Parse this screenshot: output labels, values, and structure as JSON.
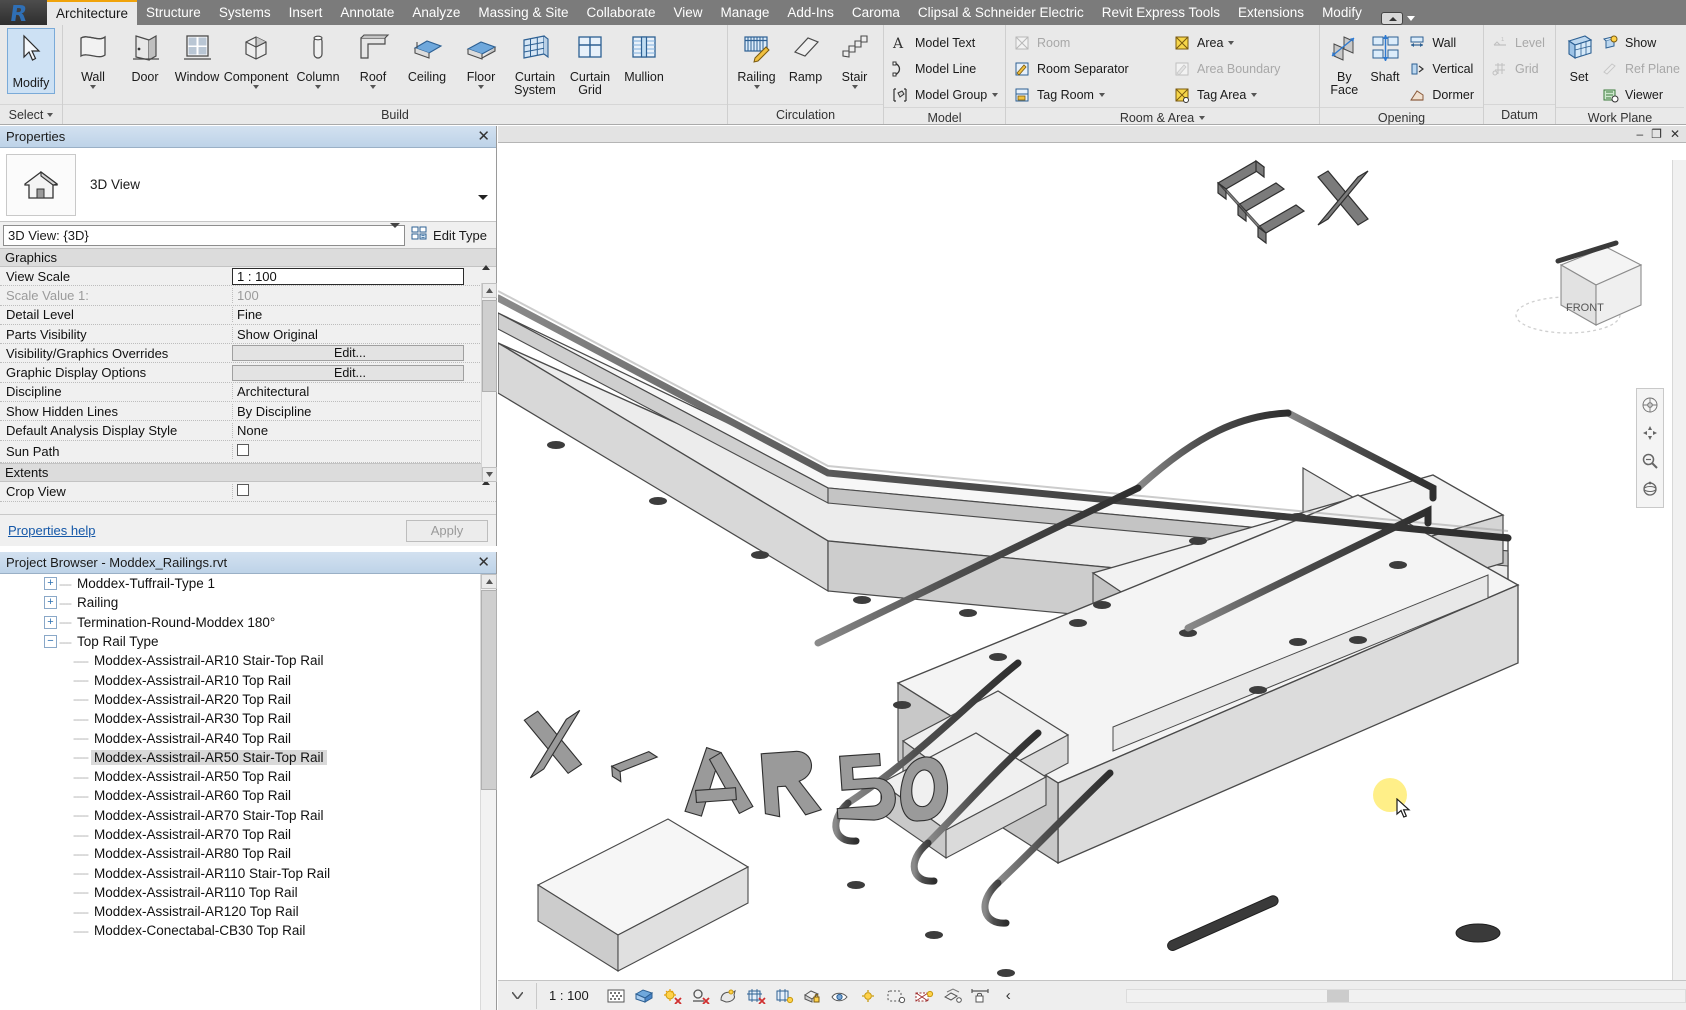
{
  "app": {
    "name": "Autodesk Revit",
    "logo": "revit-logo"
  },
  "ribbon": {
    "tabs": [
      {
        "label": "Architecture",
        "active": true
      },
      {
        "label": "Structure",
        "active": false
      },
      {
        "label": "Systems",
        "active": false
      },
      {
        "label": "Insert",
        "active": false
      },
      {
        "label": "Annotate",
        "active": false
      },
      {
        "label": "Analyze",
        "active": false
      },
      {
        "label": "Massing & Site",
        "active": false
      },
      {
        "label": "Collaborate",
        "active": false
      },
      {
        "label": "View",
        "active": false
      },
      {
        "label": "Manage",
        "active": false
      },
      {
        "label": "Add-Ins",
        "active": false
      },
      {
        "label": "Caroma",
        "active": false
      },
      {
        "label": "Clipsal & Schneider Electric",
        "active": false
      },
      {
        "label": "Revit Express Tools",
        "active": false
      },
      {
        "label": "Extensions",
        "active": false
      },
      {
        "label": "Modify",
        "active": false
      }
    ],
    "select_panel": {
      "modify_label": "Modify",
      "footer_label": "Select"
    },
    "panels": [
      {
        "title": "Build",
        "big_buttons": [
          {
            "label": "Wall",
            "icon": "wall-icon",
            "dropdown": true
          },
          {
            "label": "Door",
            "icon": "door-icon",
            "dropdown": false
          },
          {
            "label": "Window",
            "icon": "window-icon",
            "dropdown": false
          },
          {
            "label": "Component",
            "icon": "component-icon",
            "dropdown": true
          },
          {
            "label": "Column",
            "icon": "column-icon",
            "dropdown": true
          },
          {
            "label": "Roof",
            "icon": "roof-icon",
            "dropdown": true
          },
          {
            "label": "Ceiling",
            "icon": "ceiling-icon",
            "dropdown": false
          },
          {
            "label": "Floor",
            "icon": "floor-icon",
            "dropdown": true
          },
          {
            "label": "Curtain System",
            "icon": "curtain-system-icon",
            "dropdown": false
          },
          {
            "label": "Curtain Grid",
            "icon": "curtain-grid-icon",
            "dropdown": false
          },
          {
            "label": "Mullion",
            "icon": "mullion-icon",
            "dropdown": false
          }
        ]
      },
      {
        "title": "Circulation",
        "big_buttons": [
          {
            "label": "Railing",
            "icon": "railing-icon",
            "dropdown": true
          },
          {
            "label": "Ramp",
            "icon": "ramp-icon",
            "dropdown": false
          },
          {
            "label": "Stair",
            "icon": "stair-icon",
            "dropdown": true
          }
        ]
      },
      {
        "title": "Model",
        "small_buttons": [
          {
            "label": "Model Text",
            "icon": "model-text-icon",
            "disabled": false,
            "dropdown": false
          },
          {
            "label": "Model Line",
            "icon": "model-line-icon",
            "disabled": false,
            "dropdown": false
          },
          {
            "label": "Model Group",
            "icon": "model-group-icon",
            "disabled": false,
            "dropdown": true
          }
        ]
      },
      {
        "title": "Room & Area",
        "title_dropdown": true,
        "small_columns": [
          [
            {
              "label": "Room",
              "icon": "room-icon",
              "disabled": true,
              "dropdown": false
            },
            {
              "label": "Room Separator",
              "icon": "room-separator-icon",
              "disabled": false,
              "dropdown": false
            },
            {
              "label": "Tag Room",
              "icon": "tag-room-icon",
              "disabled": false,
              "dropdown": true
            }
          ],
          [
            {
              "label": "Area",
              "icon": "area-icon",
              "disabled": false,
              "dropdown": true
            },
            {
              "label": "Area Boundary",
              "icon": "area-boundary-icon",
              "disabled": true,
              "dropdown": false
            },
            {
              "label": "Tag Area",
              "icon": "tag-area-icon",
              "disabled": false,
              "dropdown": true
            }
          ]
        ]
      },
      {
        "title": "Opening",
        "big_buttons": [
          {
            "label": "By Face",
            "icon": "by-face-icon",
            "dropdown": false
          },
          {
            "label": "Shaft",
            "icon": "shaft-icon",
            "dropdown": false
          }
        ],
        "small_buttons": [
          {
            "label": "Wall",
            "icon": "opening-wall-icon",
            "disabled": false,
            "dropdown": false
          },
          {
            "label": "Vertical",
            "icon": "opening-vertical-icon",
            "disabled": false,
            "dropdown": false
          },
          {
            "label": "Dormer",
            "icon": "opening-dormer-icon",
            "disabled": false,
            "dropdown": false
          }
        ]
      },
      {
        "title": "Datum",
        "small_buttons": [
          {
            "label": "Level",
            "icon": "level-icon",
            "disabled": true,
            "dropdown": false
          },
          {
            "label": "Grid",
            "icon": "grid-icon",
            "disabled": true,
            "dropdown": false
          }
        ]
      },
      {
        "title": "Work Plane",
        "big_buttons": [
          {
            "label": "Set",
            "icon": "set-workplane-icon",
            "dropdown": false
          }
        ],
        "small_buttons": [
          {
            "label": "Show",
            "icon": "show-workplane-icon",
            "disabled": false,
            "dropdown": false
          },
          {
            "label": "Ref Plane",
            "icon": "ref-plane-icon",
            "disabled": true,
            "dropdown": false
          },
          {
            "label": "Viewer",
            "icon": "workplane-viewer-icon",
            "disabled": false,
            "dropdown": false
          }
        ]
      }
    ]
  },
  "properties": {
    "title": "Properties",
    "close_icon": "close-icon",
    "type_name": "3D View",
    "type_icon": "3d-view-house-icon",
    "selector_value": "3D View: {3D}",
    "edit_type_label": "Edit Type",
    "edit_type_icon": "edit-type-icon",
    "groups": [
      {
        "name": "Graphics",
        "rows": [
          {
            "key": "View Scale",
            "value": "1 : 100",
            "style": "boxed",
            "dim": false
          },
          {
            "key": "Scale Value      1:",
            "value": "100",
            "style": "plain",
            "dim": true
          },
          {
            "key": "Detail Level",
            "value": "Fine",
            "style": "plain",
            "dim": false
          },
          {
            "key": "Parts Visibility",
            "value": "Show Original",
            "style": "plain",
            "dim": false
          },
          {
            "key": "Visibility/Graphics Overrides",
            "value": "Edit...",
            "style": "button",
            "dim": false
          },
          {
            "key": "Graphic Display Options",
            "value": "Edit...",
            "style": "button",
            "dim": false
          },
          {
            "key": "Discipline",
            "value": "Architectural",
            "style": "plain",
            "dim": false
          },
          {
            "key": "Show Hidden Lines",
            "value": "By Discipline",
            "style": "plain",
            "dim": false
          },
          {
            "key": "Default Analysis Display Style",
            "value": "None",
            "style": "plain",
            "dim": false
          },
          {
            "key": "Sun Path",
            "value": "",
            "style": "checkbox",
            "dim": false
          }
        ]
      },
      {
        "name": "Extents",
        "rows": [
          {
            "key": "Crop View",
            "value": "",
            "style": "checkbox",
            "dim": false
          }
        ]
      }
    ],
    "help_label": "Properties help",
    "apply_label": "Apply"
  },
  "browser": {
    "title": "Project Browser - Moddex_Railings.rvt",
    "close_icon": "close-icon",
    "nodes": [
      {
        "label": "Moddex-Tuffrail-Type 1",
        "depth": 1,
        "expander": "+",
        "selected": false
      },
      {
        "label": "Railing",
        "depth": 1,
        "expander": "+",
        "selected": false
      },
      {
        "label": "Termination-Round-Moddex 180°",
        "depth": 1,
        "expander": "+",
        "selected": false
      },
      {
        "label": "Top Rail Type",
        "depth": 1,
        "expander": "-",
        "selected": false
      },
      {
        "label": "Moddex-Assistrail-AR10 Stair-Top Rail",
        "depth": 2,
        "expander": "",
        "selected": false
      },
      {
        "label": "Moddex-Assistrail-AR10 Top Rail",
        "depth": 2,
        "expander": "",
        "selected": false
      },
      {
        "label": "Moddex-Assistrail-AR20 Top Rail",
        "depth": 2,
        "expander": "",
        "selected": false
      },
      {
        "label": "Moddex-Assistrail-AR30 Top Rail",
        "depth": 2,
        "expander": "",
        "selected": false
      },
      {
        "label": "Moddex-Assistrail-AR40 Top Rail",
        "depth": 2,
        "expander": "",
        "selected": false
      },
      {
        "label": "Moddex-Assistrail-AR50 Stair-Top Rail",
        "depth": 2,
        "expander": "",
        "selected": true
      },
      {
        "label": "Moddex-Assistrail-AR50 Top Rail",
        "depth": 2,
        "expander": "",
        "selected": false
      },
      {
        "label": "Moddex-Assistrail-AR60 Top Rail",
        "depth": 2,
        "expander": "",
        "selected": false
      },
      {
        "label": "Moddex-Assistrail-AR70 Stair-Top Rail",
        "depth": 2,
        "expander": "",
        "selected": false
      },
      {
        "label": "Moddex-Assistrail-AR70 Top Rail",
        "depth": 2,
        "expander": "",
        "selected": false
      },
      {
        "label": "Moddex-Assistrail-AR80 Top Rail",
        "depth": 2,
        "expander": "",
        "selected": false
      },
      {
        "label": "Moddex-Assistrail-AR110 Stair-Top Rail",
        "depth": 2,
        "expander": "",
        "selected": false
      },
      {
        "label": "Moddex-Assistrail-AR110 Top Rail",
        "depth": 2,
        "expander": "",
        "selected": false
      },
      {
        "label": "Moddex-Assistrail-AR120 Top Rail",
        "depth": 2,
        "expander": "",
        "selected": false
      },
      {
        "label": "Moddex-Conectabal-CB30 Top Rail",
        "depth": 2,
        "expander": "",
        "selected": false
      }
    ]
  },
  "viewport": {
    "window_controls": [
      {
        "label": "–",
        "name": "minimize-view-button"
      },
      {
        "label": "❐",
        "name": "restore-view-button"
      },
      {
        "label": "✕",
        "name": "close-view-button"
      }
    ],
    "viewcube": {
      "face_label": "FRONT",
      "name": "view-cube"
    },
    "navbar_icons": [
      "steering-wheel-icon",
      "pan-icon",
      "zoom-extents-icon",
      "orbit-icon"
    ],
    "model_text": [
      "EX",
      "X - AR50"
    ],
    "status_bar": {
      "scale": "1 : 100",
      "icons": [
        "detail-level-icon",
        "visual-style-icon",
        "sun-path-icon",
        "shadows-off-icon",
        "render-icon",
        "crop-view-icon",
        "show-crop-region-icon",
        "lock-3d-view-icon",
        "temporary-hide-isolate-icon",
        "reveal-hidden-elements-icon",
        "temporary-view-properties-icon",
        "show-analytical-model-icon",
        "highlight-displacement-sets-icon",
        "constraints-icon"
      ],
      "collapse_label": "‹"
    }
  },
  "colors": {
    "tabstrip_bg": "#7b7b7b",
    "ribbon_bg": "#e9e9e9",
    "accent_tab": "#f0a30a",
    "palette_title": "#bed3e8",
    "selection_hl": "#d9d9d9",
    "link": "#1558a8",
    "modify_btn": "#cde1f4",
    "cursor_highlight": "#ffeb6e"
  }
}
